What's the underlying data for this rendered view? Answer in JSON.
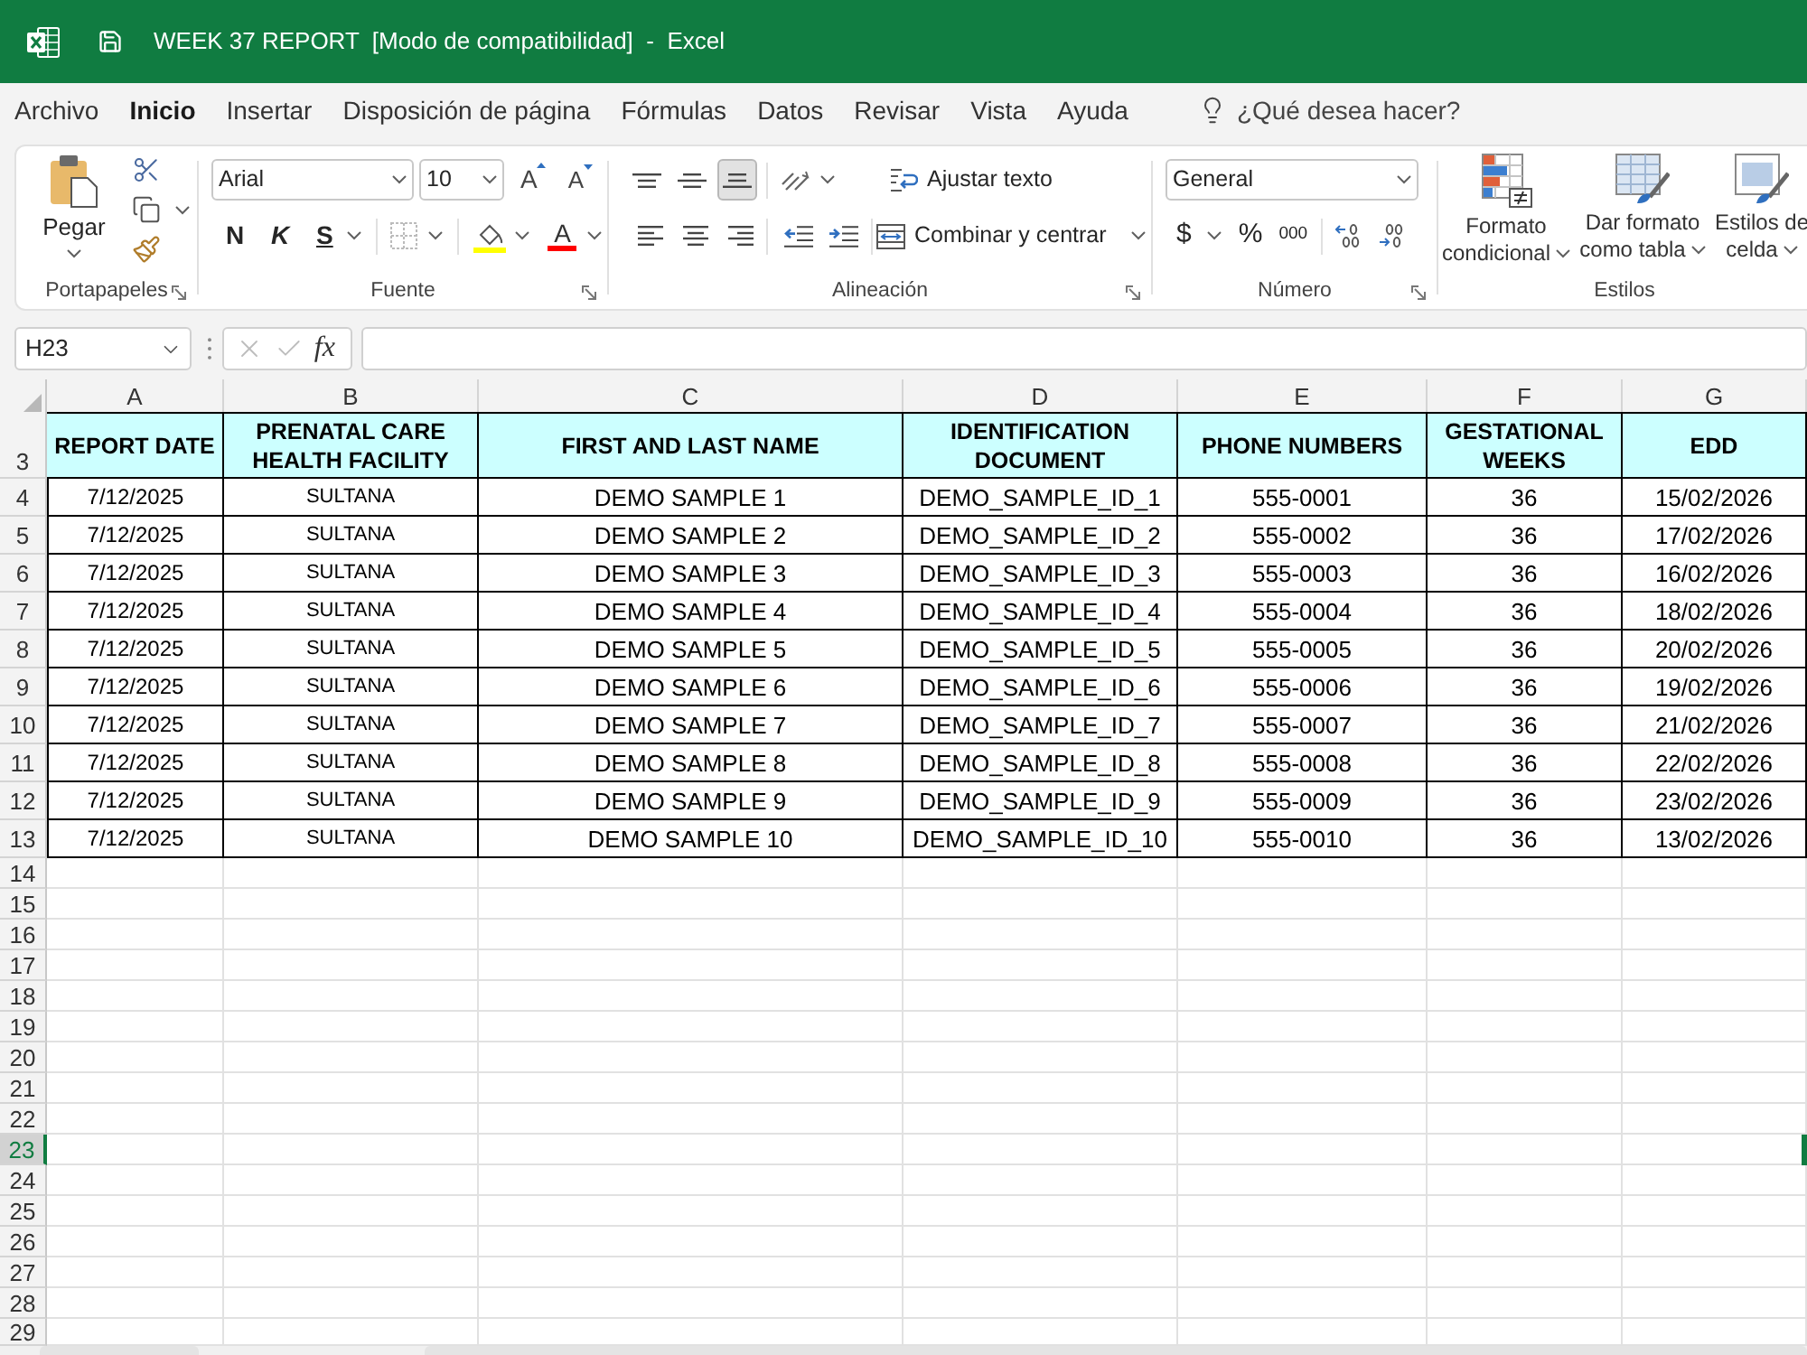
{
  "window": {
    "title": "WEEK 37 REPORT  [Modo de compatibilidad]  -  Excel"
  },
  "menu": {
    "tabs": [
      {
        "label": "Archivo",
        "selected": false
      },
      {
        "label": "Inicio",
        "selected": true
      },
      {
        "label": "Insertar",
        "selected": false
      },
      {
        "label": "Disposición de página",
        "selected": false
      },
      {
        "label": "Fórmulas",
        "selected": false
      },
      {
        "label": "Datos",
        "selected": false
      },
      {
        "label": "Revisar",
        "selected": false
      },
      {
        "label": "Vista",
        "selected": false
      },
      {
        "label": "Ayuda",
        "selected": false
      }
    ],
    "search": {
      "placeholder": "¿Qué desea hacer?"
    }
  },
  "ribbon": {
    "clipboard": {
      "paste": "Pegar",
      "caption": "Portapapeles"
    },
    "font": {
      "family": "Arial",
      "size": "10",
      "grow": "A",
      "shrink": "A",
      "bold": "N",
      "italic": "K",
      "underline": "S",
      "font_color_button": "A",
      "caption": "Fuente"
    },
    "alignment": {
      "vertical": [
        {
          "kind": "top",
          "selected": false
        },
        {
          "kind": "middle",
          "selected": false
        },
        {
          "kind": "bottom",
          "selected": true
        }
      ],
      "wrap": "Ajustar texto",
      "merge": "Combinar y centrar",
      "caption": "Alineación"
    },
    "number": {
      "format": "General",
      "currency": "$",
      "percent": "%",
      "thousands": "000",
      "caption": "Número"
    },
    "styles": {
      "buttons": [
        {
          "kind": "conditional",
          "label": "Formato condicional"
        },
        {
          "kind": "table",
          "label": "Dar formato como tabla"
        },
        {
          "kind": "cell",
          "label": "Estilos de celda"
        }
      ],
      "caption": "Estilos"
    }
  },
  "formula_bar": {
    "name_box": "H23",
    "function_label": "fx"
  },
  "sheet": {
    "columns": [
      "A",
      "B",
      "C",
      "D",
      "E",
      "F",
      "G"
    ],
    "header_row": {
      "number": "3",
      "selected": false,
      "cells": [
        "REPORT DATE",
        "PRENATAL CARE HEALTH FACILITY",
        "FIRST AND LAST NAME",
        "IDENTIFICATION DOCUMENT",
        "PHONE NUMBERS",
        "GESTATIONAL WEEKS",
        "EDD"
      ]
    },
    "rows": [
      {
        "number": "4",
        "selected": false,
        "cells": [
          "7/12/2025",
          "SULTANA",
          "DEMO SAMPLE 1",
          "DEMO_SAMPLE_ID_1",
          "555-0001",
          "36",
          "15/02/2026"
        ]
      },
      {
        "number": "5",
        "selected": false,
        "cells": [
          "7/12/2025",
          "SULTANA",
          "DEMO SAMPLE 2",
          "DEMO_SAMPLE_ID_2",
          "555-0002",
          "36",
          "17/02/2026"
        ]
      },
      {
        "number": "6",
        "selected": false,
        "cells": [
          "7/12/2025",
          "SULTANA",
          "DEMO SAMPLE 3",
          "DEMO_SAMPLE_ID_3",
          "555-0003",
          "36",
          "16/02/2026"
        ]
      },
      {
        "number": "7",
        "selected": false,
        "cells": [
          "7/12/2025",
          "SULTANA",
          "DEMO SAMPLE 4",
          "DEMO_SAMPLE_ID_4",
          "555-0004",
          "36",
          "18/02/2026"
        ]
      },
      {
        "number": "8",
        "selected": false,
        "cells": [
          "7/12/2025",
          "SULTANA",
          "DEMO SAMPLE 5",
          "DEMO_SAMPLE_ID_5",
          "555-0005",
          "36",
          "20/02/2026"
        ]
      },
      {
        "number": "9",
        "selected": false,
        "cells": [
          "7/12/2025",
          "SULTANA",
          "DEMO SAMPLE 6",
          "DEMO_SAMPLE_ID_6",
          "555-0006",
          "36",
          "19/02/2026"
        ]
      },
      {
        "number": "10",
        "selected": false,
        "cells": [
          "7/12/2025",
          "SULTANA",
          "DEMO SAMPLE 7",
          "DEMO_SAMPLE_ID_7",
          "555-0007",
          "36",
          "21/02/2026"
        ]
      },
      {
        "number": "11",
        "selected": false,
        "cells": [
          "7/12/2025",
          "SULTANA",
          "DEMO SAMPLE 8",
          "DEMO_SAMPLE_ID_8",
          "555-0008",
          "36",
          "22/02/2026"
        ]
      },
      {
        "number": "12",
        "selected": false,
        "cells": [
          "7/12/2025",
          "SULTANA",
          "DEMO SAMPLE 9",
          "DEMO_SAMPLE_ID_9",
          "555-0009",
          "36",
          "23/02/2026"
        ]
      },
      {
        "number": "13",
        "selected": false,
        "cells": [
          "7/12/2025",
          "SULTANA",
          "DEMO SAMPLE 10",
          "DEMO_SAMPLE_ID_10",
          "555-0010",
          "36",
          "13/02/2026"
        ]
      }
    ],
    "empty_rows": [
      {
        "number": "14",
        "selected": false
      },
      {
        "number": "15",
        "selected": false
      },
      {
        "number": "16",
        "selected": false
      },
      {
        "number": "17",
        "selected": false
      },
      {
        "number": "18",
        "selected": false
      },
      {
        "number": "19",
        "selected": false
      },
      {
        "number": "20",
        "selected": false
      },
      {
        "number": "21",
        "selected": false
      },
      {
        "number": "22",
        "selected": false
      },
      {
        "number": "23",
        "selected": true
      },
      {
        "number": "24",
        "selected": false
      },
      {
        "number": "25",
        "selected": false
      },
      {
        "number": "26",
        "selected": false
      },
      {
        "number": "27",
        "selected": false
      },
      {
        "number": "28",
        "selected": false
      },
      {
        "number": "29",
        "selected": false
      }
    ]
  }
}
